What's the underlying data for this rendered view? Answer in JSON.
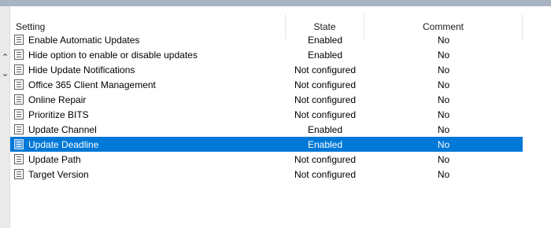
{
  "columns": {
    "setting": "Setting",
    "state": "State",
    "comment": "Comment"
  },
  "icons": {
    "row_icon": "policy-setting-icon",
    "scroll_up": "chevron-up-icon",
    "scroll_down": "chevron-down-icon"
  },
  "colors": {
    "selection": "#0078d7"
  },
  "selected_row": "Update Deadline",
  "rows": [
    {
      "setting": "Enable Automatic Updates",
      "state": "Enabled",
      "comment": "No"
    },
    {
      "setting": "Hide option to enable or disable updates",
      "state": "Enabled",
      "comment": "No"
    },
    {
      "setting": "Hide Update Notifications",
      "state": "Not configured",
      "comment": "No"
    },
    {
      "setting": "Office 365 Client Management",
      "state": "Not configured",
      "comment": "No"
    },
    {
      "setting": "Online Repair",
      "state": "Not configured",
      "comment": "No"
    },
    {
      "setting": "Prioritize BITS",
      "state": "Not configured",
      "comment": "No"
    },
    {
      "setting": "Update Channel",
      "state": "Enabled",
      "comment": "No"
    },
    {
      "setting": "Update Deadline",
      "state": "Enabled",
      "comment": "No"
    },
    {
      "setting": "Update Path",
      "state": "Not configured",
      "comment": "No"
    },
    {
      "setting": "Target Version",
      "state": "Not configured",
      "comment": "No"
    }
  ]
}
